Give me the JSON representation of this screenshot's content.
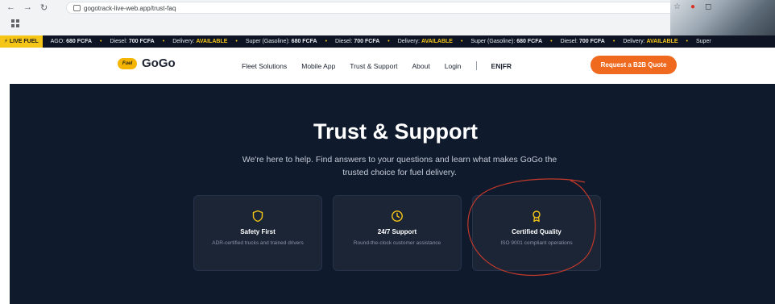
{
  "browser": {
    "url": "gogotrack-live-web.app/trust-faq",
    "back": "←",
    "forward": "→",
    "reload": "↻"
  },
  "ticker": {
    "live_label": "⚡ LIVE FUEL",
    "items": [
      {
        "label": "AGO:",
        "value": "680 FCFA"
      },
      {
        "label": "Diesel:",
        "value": "700 FCFA"
      },
      {
        "label": "Delivery:",
        "value": "AVAILABLE"
      },
      {
        "label": "Super (Gasoline):",
        "value": "680 FCFA"
      },
      {
        "label": "Diesel:",
        "value": "700 FCFA"
      },
      {
        "label": "Delivery:",
        "value": "AVAILABLE"
      },
      {
        "label": "Super (Gasoline):",
        "value": "680 FCFA"
      },
      {
        "label": "Diesel:",
        "value": "700 FCFA"
      },
      {
        "label": "Delivery:",
        "value": "AVAILABLE"
      },
      {
        "label": "Super",
        "value": ""
      }
    ]
  },
  "header": {
    "logo_mark": "Fuel",
    "logo_text": "GoGo",
    "nav": [
      "Fleet Solutions",
      "Mobile App",
      "Trust & Support",
      "About",
      "Login"
    ],
    "lang": "EN|FR",
    "cta": "Request a B2B Quote"
  },
  "hero": {
    "title": "Trust & Support",
    "subtitle": "We're here to help. Find answers to your questions and learn what makes GoGo the trusted choice for fuel delivery."
  },
  "cards": [
    {
      "icon": "shield-icon",
      "title": "Safety First",
      "desc": "ADR-certified trucks and trained drivers"
    },
    {
      "icon": "clock-icon",
      "title": "24/7 Support",
      "desc": "Round-the-clock customer assistance"
    },
    {
      "icon": "award-icon",
      "title": "Certified Quality",
      "desc": "ISO 9001 compliant operations"
    }
  ],
  "colors": {
    "accent": "#f5c518",
    "cta": "#ef6a1f",
    "hero_bg": "#0f1a2c",
    "card_bg": "#1b2536",
    "annotation": "#c0392b"
  }
}
